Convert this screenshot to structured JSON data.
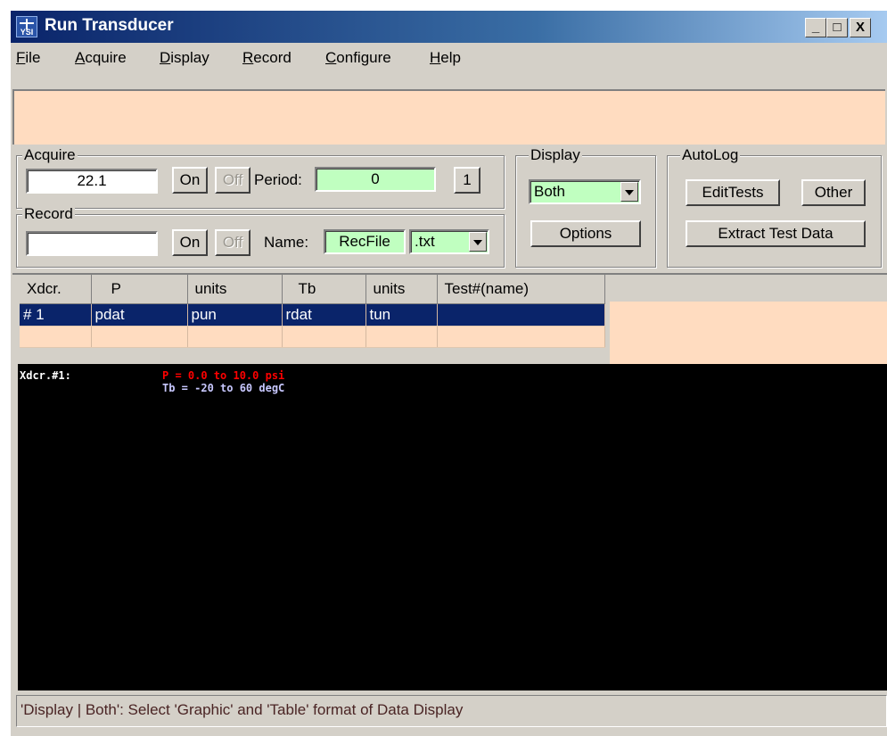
{
  "window": {
    "title": "Run Transducer",
    "icon": "ysi-app-icon",
    "icon_text": "YSI"
  },
  "titlebar": {
    "minimize": "_",
    "maximize": "□",
    "close": "X"
  },
  "menu": [
    {
      "label": "File",
      "mnemonic": "F",
      "rest": "ile"
    },
    {
      "label": "Acquire",
      "mnemonic": "A",
      "rest": "cquire"
    },
    {
      "label": "Display",
      "mnemonic": "D",
      "rest": "isplay"
    },
    {
      "label": "Record",
      "mnemonic": "R",
      "rest": "ecord"
    },
    {
      "label": "Configure",
      "mnemonic": "C",
      "rest": "onfigure"
    },
    {
      "label": "Help",
      "mnemonic": "H",
      "rest": "elp"
    }
  ],
  "acquire": {
    "label": "Acquire",
    "value": "22.1",
    "on": "On",
    "off": "Off",
    "period_label": "Period:",
    "period_value": "0",
    "step_button": "1"
  },
  "record": {
    "label": "Record",
    "value": "",
    "on": "On",
    "off": "Off",
    "name_label": "Name:",
    "name_value": "RecFile",
    "ext_value": ".txt"
  },
  "display": {
    "label": "Display",
    "selected": "Both",
    "options_button": "Options"
  },
  "autolog": {
    "label": "AutoLog",
    "edit_tests": "EditTests",
    "other": "Other",
    "extract": "Extract Test Data"
  },
  "table": {
    "columns": [
      "Xdcr.",
      "P",
      "units",
      "Tb",
      "units",
      "Test#(name)"
    ],
    "rows": [
      [
        "# 1",
        "pdat",
        "pun",
        "rdat",
        "tun",
        ""
      ]
    ]
  },
  "plot": {
    "xdcr_label": "Xdcr.#1:",
    "p_range": "P =  0.0 to 10.0 psi",
    "tb_range": "Tb = -20 to 60 degC",
    "colors": {
      "p": "#ff0000",
      "tb": "#c8c8ff",
      "label": "#ffffff"
    }
  },
  "status": {
    "text": "'Display | Both': Select 'Graphic' and 'Table' format of Data Display"
  }
}
